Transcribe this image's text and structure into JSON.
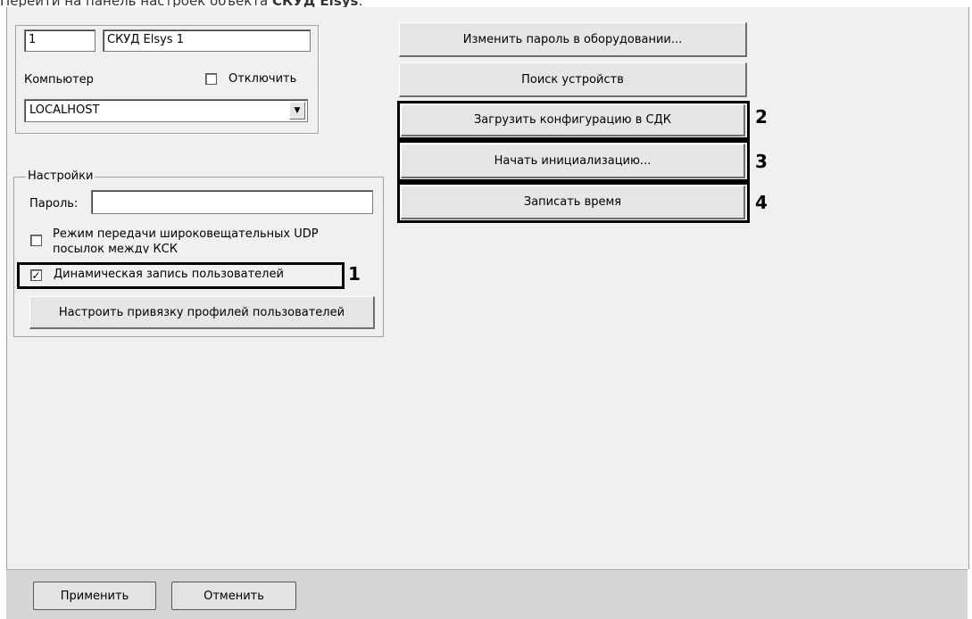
{
  "caption": {
    "prefix": "Перейти на панель настроек объекта ",
    "bold": "СКУД Elsys",
    "suffix": "."
  },
  "object": {
    "id": "1",
    "name": "СКУД Elsys 1"
  },
  "computer": {
    "label": "Компьютер",
    "disable_label": "Отключить",
    "disable_checked": false,
    "value": "LOCALHOST"
  },
  "settings": {
    "title": "Настройки",
    "password_label": "Пароль:",
    "password_value": "",
    "broadcast_label_line1": "Режим передачи широковещательных UDP",
    "broadcast_label_line2": "посылок между КСК",
    "broadcast_checked": false,
    "dynamic_label": "Динамическая запись пользователей",
    "dynamic_checked": true,
    "profile_button": "Настроить привязку профилей пользователей"
  },
  "actions": {
    "change_password": "Изменить пароль в оборудовании...",
    "search_devices": "Поиск устройств",
    "load_config": "Загрузить конфигурацию в СДК",
    "start_init": "Начать инициализацию...",
    "write_time": "Записать время"
  },
  "callouts": [
    "1",
    "2",
    "3",
    "4"
  ],
  "footer": {
    "apply": "Применить",
    "cancel": "Отменить"
  },
  "colors": {
    "panel_bg": "#f0f0f0",
    "footer_bg": "#d6d6d6",
    "callout": "#000000"
  }
}
